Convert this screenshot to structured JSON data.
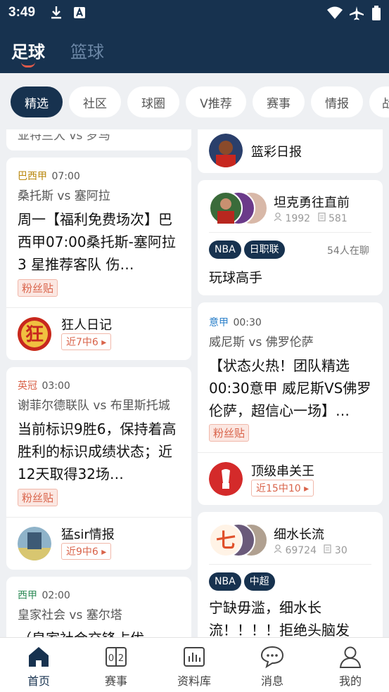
{
  "status_bar": {
    "time": "3:49"
  },
  "sport_tabs": [
    {
      "label": "足球",
      "active": true
    },
    {
      "label": "篮球",
      "active": false
    }
  ],
  "filter_chips": [
    {
      "label": "精选",
      "active": true
    },
    {
      "label": "社区"
    },
    {
      "label": "球圈"
    },
    {
      "label": "V推荐"
    },
    {
      "label": "赛事"
    },
    {
      "label": "情报"
    },
    {
      "label": "战"
    }
  ],
  "left_cards": {
    "partial_top": {
      "text": "亚特兰大 vs 罗马"
    },
    "card1": {
      "league": "巴西甲",
      "time": "07:00",
      "league_color": "#b8860b",
      "teams": "桑托斯 vs 塞阿拉",
      "title": "周一【福利免费场次】巴西甲07:00桑托斯-塞阿拉 3 星推荐客队 伤…",
      "tag": "粉丝贴",
      "author": "狂人日记",
      "record": "近7中6"
    },
    "card2": {
      "league": "英冠",
      "time": "03:00",
      "league_color": "#d9634a",
      "teams": "谢菲尔德联队 vs 布里斯托城",
      "title": "当前标识9胜6，保持着高胜利的标识成绩状态；近12天取得32场…",
      "tag": "粉丝贴",
      "author": "猛sir情报",
      "record": "近9中6"
    },
    "card3": {
      "league": "西甲",
      "time": "02:00",
      "league_color": "#2e8b57",
      "teams": "皇家社会 vs 塞尔塔",
      "title": "（皇家社会交锋占优"
    }
  },
  "right_cards": {
    "partial_top": {
      "name": "篮彩日报"
    },
    "circle1": {
      "name": "坦克勇往直前",
      "members": "1992",
      "posts": "581",
      "tags": [
        "NBA",
        "日职联"
      ],
      "online": "54人在聊",
      "post": "玩球高手"
    },
    "card2": {
      "league": "意甲",
      "time": "00:30",
      "league_color": "#2a7fc9",
      "teams": "威尼斯 vs 佛罗伦萨",
      "title": "【状态火热！团队精选00:30意甲 威尼斯VS佛罗伦萨，超信心一场】…",
      "tag": "粉丝贴",
      "author": "顶级串关王",
      "record": "近15中10"
    },
    "circle2": {
      "name": "细水长流",
      "members": "69724",
      "posts": "30",
      "tags": [
        "NBA",
        "中超"
      ],
      "post": "宁缺毋滥，细水长流！！！！拒绝头脑发"
    }
  },
  "bottom_nav": [
    {
      "label": "首页",
      "icon": "home-icon",
      "active": true
    },
    {
      "label": "赛事",
      "icon": "scoreboard-icon"
    },
    {
      "label": "资料库",
      "icon": "chart-icon"
    },
    {
      "label": "消息",
      "icon": "chat-icon"
    },
    {
      "label": "我的",
      "icon": "person-icon"
    }
  ],
  "colors": {
    "primary": "#17324f",
    "accent": "#d9634a",
    "background": "#eef0f3"
  }
}
